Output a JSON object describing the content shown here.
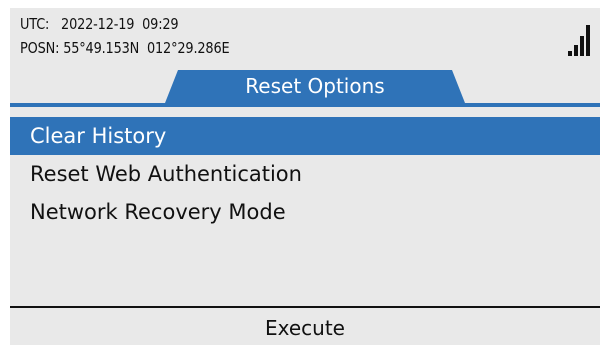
{
  "status": {
    "utc_label": "UTC:",
    "utc_value": "2022-12-19  09:29",
    "posn_label": "POSN:",
    "posn_value": "55°49.153N  012°29.286E",
    "signal_icon": "signal-strength-icon",
    "signal_bars": 4
  },
  "tab": {
    "title": "Reset Options"
  },
  "menu": {
    "items": [
      {
        "label": "Clear History",
        "selected": true
      },
      {
        "label": "Reset Web Authentication",
        "selected": false
      },
      {
        "label": "Network Recovery Mode",
        "selected": false
      }
    ]
  },
  "softkey": {
    "label": "Execute"
  },
  "colors": {
    "accent": "#2f73b8",
    "background": "#e9e9e9",
    "text": "#111111",
    "selected_text": "#ffffff"
  }
}
